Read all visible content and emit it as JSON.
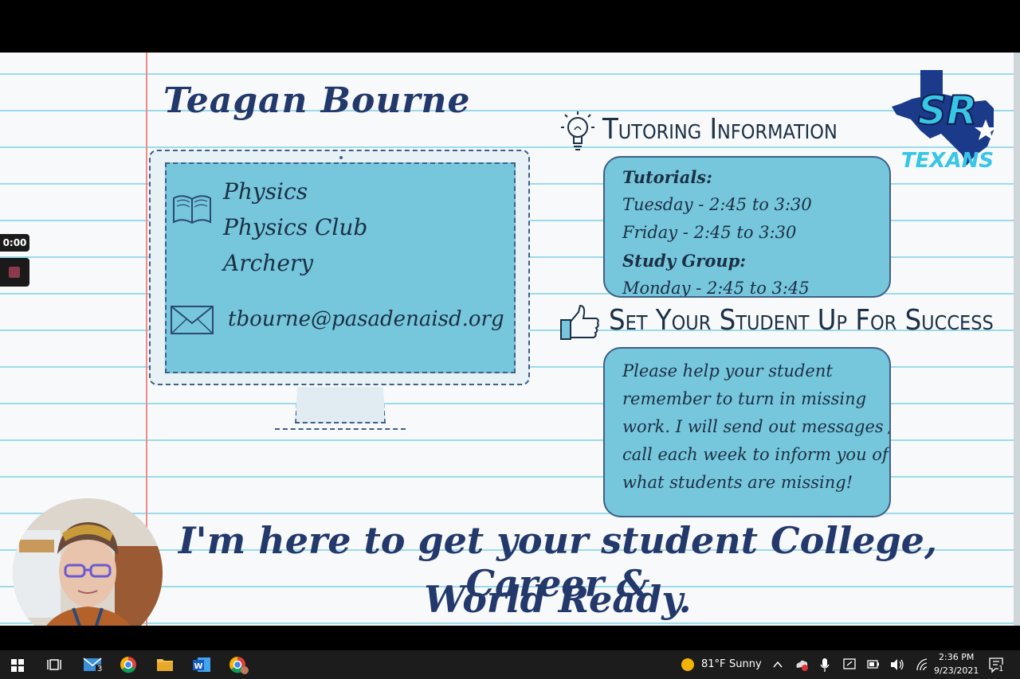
{
  "slide": {
    "name": "Teagan Bourne",
    "subjects": [
      "Physics",
      "Physics Club",
      "Archery"
    ],
    "email": "tbourne@pasadenaisd.org",
    "tutoring": {
      "title": "Tutoring Information",
      "lines": [
        {
          "text": "Tutorials:",
          "bold": true
        },
        {
          "text": "Tuesday - 2:45 to 3:30",
          "bold": false
        },
        {
          "text": "Friday - 2:45 to 3:30",
          "bold": false
        },
        {
          "text": "Study Group:",
          "bold": true
        },
        {
          "text": "Monday - 2:45 to 3:45",
          "bold": false
        }
      ]
    },
    "success": {
      "title": "Set Your Student Up For Success",
      "lines": [
        "Please help your student",
        "remember to turn in missing",
        "work. I will send out messages /",
        "call each week to inform you of",
        "what students are missing!"
      ]
    },
    "logo": {
      "letters": "SR",
      "word": "TEXANS",
      "colors": {
        "state": "#1b3a8a",
        "letters": "#38c6e6"
      }
    },
    "tagline": [
      "I'm here to get your student College, Career &",
      "World Ready."
    ]
  },
  "recorder": {
    "timer": "0:00"
  },
  "taskbar": {
    "mail_badge": "3",
    "weather": {
      "temp": "81°F",
      "condition": "Sunny"
    },
    "time": "2:36 PM",
    "date": "9/23/2021",
    "notification_count": "1"
  },
  "colors": {
    "accent": "#76c6dc",
    "ink": "#1b2f45",
    "title_ink": "#23386b",
    "rule": "#7dd0e6",
    "margin": "#f08a8a"
  }
}
